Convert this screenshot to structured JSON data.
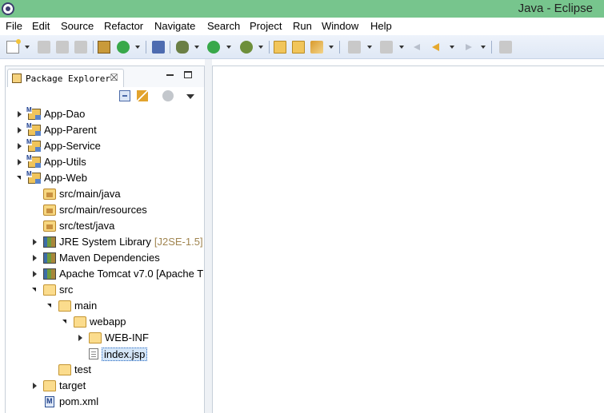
{
  "window": {
    "title": "Java - Eclipse"
  },
  "menubar": {
    "items": [
      "File",
      "Edit",
      "Source",
      "Refactor",
      "Navigate",
      "Search",
      "Project",
      "Run",
      "Window",
      "Help"
    ]
  },
  "package_explorer": {
    "tab_label": "Package Explorer",
    "tab_close_glyph": "⛝",
    "tree": [
      {
        "label": "App-Dao",
        "icon": "maven-project-icon",
        "expanded": false
      },
      {
        "label": "App-Parent",
        "icon": "maven-project-icon",
        "expanded": false
      },
      {
        "label": "App-Service",
        "icon": "maven-project-icon",
        "expanded": false
      },
      {
        "label": "App-Utils",
        "icon": "maven-project-icon",
        "expanded": false
      },
      {
        "label": "App-Web",
        "icon": "maven-project-icon",
        "expanded": true
      },
      {
        "label": "src/main/java",
        "icon": "source-folder-icon"
      },
      {
        "label": "src/main/resources",
        "icon": "source-folder-icon"
      },
      {
        "label": "src/test/java",
        "icon": "source-folder-icon"
      },
      {
        "label": "JRE System Library",
        "decoration": "[J2SE-1.5]",
        "icon": "library-icon",
        "expanded": false
      },
      {
        "label": "Maven Dependencies",
        "icon": "library-icon",
        "expanded": false
      },
      {
        "label": "Apache Tomcat v7.0 [Apache T",
        "icon": "library-icon",
        "expanded": false
      },
      {
        "label": "src",
        "icon": "folder-icon",
        "expanded": true
      },
      {
        "label": "main",
        "icon": "folder-icon",
        "expanded": true
      },
      {
        "label": "webapp",
        "icon": "folder-icon",
        "expanded": true
      },
      {
        "label": "WEB-INF",
        "icon": "folder-icon",
        "expanded": false
      },
      {
        "label": "index.jsp",
        "icon": "jsp-file-icon",
        "selected": true
      },
      {
        "label": "test",
        "icon": "folder-icon"
      },
      {
        "label": "target",
        "icon": "folder-icon",
        "expanded": false
      },
      {
        "label": "pom.xml",
        "icon": "pom-file-icon"
      }
    ]
  },
  "colors": {
    "titlebar": "#77c58d",
    "toolbar": "#dfe8f5",
    "selection": "#d5e6f8",
    "decoration": "#a08550"
  }
}
